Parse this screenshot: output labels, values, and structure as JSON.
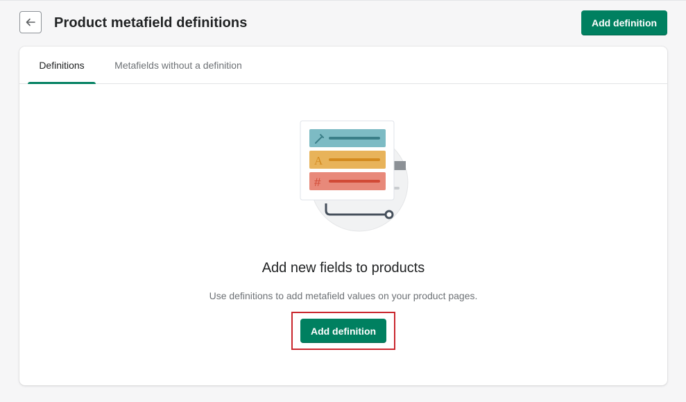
{
  "header": {
    "title": "Product metafield definitions",
    "back_icon": "arrow-left-icon",
    "add_button_label": "Add definition"
  },
  "tabs": [
    {
      "label": "Definitions",
      "selected": true
    },
    {
      "label": "Metafields without a definition",
      "selected": false
    }
  ],
  "empty_state": {
    "illustration": "metafield-fields-illustration",
    "heading": "Add new fields to products",
    "description": "Use definitions to add metafield values on your product pages.",
    "button_label": "Add definition"
  },
  "colors": {
    "primary": "#008060",
    "highlight": "#c9252c",
    "teal_field": "#7dbbc4",
    "yellow_field": "#e8b35a",
    "red_field": "#e8897a"
  }
}
